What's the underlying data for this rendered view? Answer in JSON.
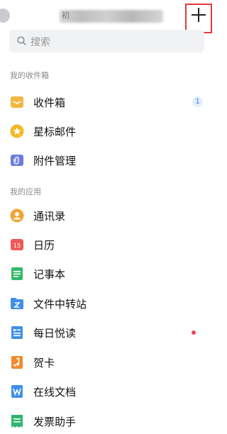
{
  "header": {
    "title_visible_fragment": "初",
    "add_icon": "plus-icon"
  },
  "search": {
    "placeholder": "搜索",
    "icon": "search-icon"
  },
  "sections": {
    "mailbox": {
      "title": "我的收件箱",
      "items": [
        {
          "label": "收件箱",
          "icon": "inbox-tray-icon",
          "color": "#f3b53f",
          "badge": "1"
        },
        {
          "label": "星标邮件",
          "icon": "star-icon",
          "color": "#f5b825"
        },
        {
          "label": "附件管理",
          "icon": "attachment-icon",
          "color": "#6c7ce0"
        }
      ]
    },
    "apps": {
      "title": "我的应用",
      "items": [
        {
          "label": "通讯录",
          "icon": "contacts-icon",
          "color": "#f2a534"
        },
        {
          "label": "日历",
          "icon": "calendar-icon",
          "color": "#ee5a5a",
          "icon_text": "15"
        },
        {
          "label": "记事本",
          "icon": "notebook-icon",
          "color": "#35b86a"
        },
        {
          "label": "文件中转站",
          "icon": "file-transfer-icon",
          "color": "#3f8fe6"
        },
        {
          "label": "每日悦读",
          "icon": "reading-icon",
          "color": "#3f8fe6",
          "dot_color": "#e8495a"
        },
        {
          "label": "贺卡",
          "icon": "greeting-card-icon",
          "color": "#f28a2c"
        },
        {
          "label": "在线文档",
          "icon": "online-doc-icon",
          "color": "#3f8fe6"
        },
        {
          "label": "发票助手",
          "icon": "invoice-icon",
          "color": "#2fb56b"
        }
      ]
    }
  }
}
